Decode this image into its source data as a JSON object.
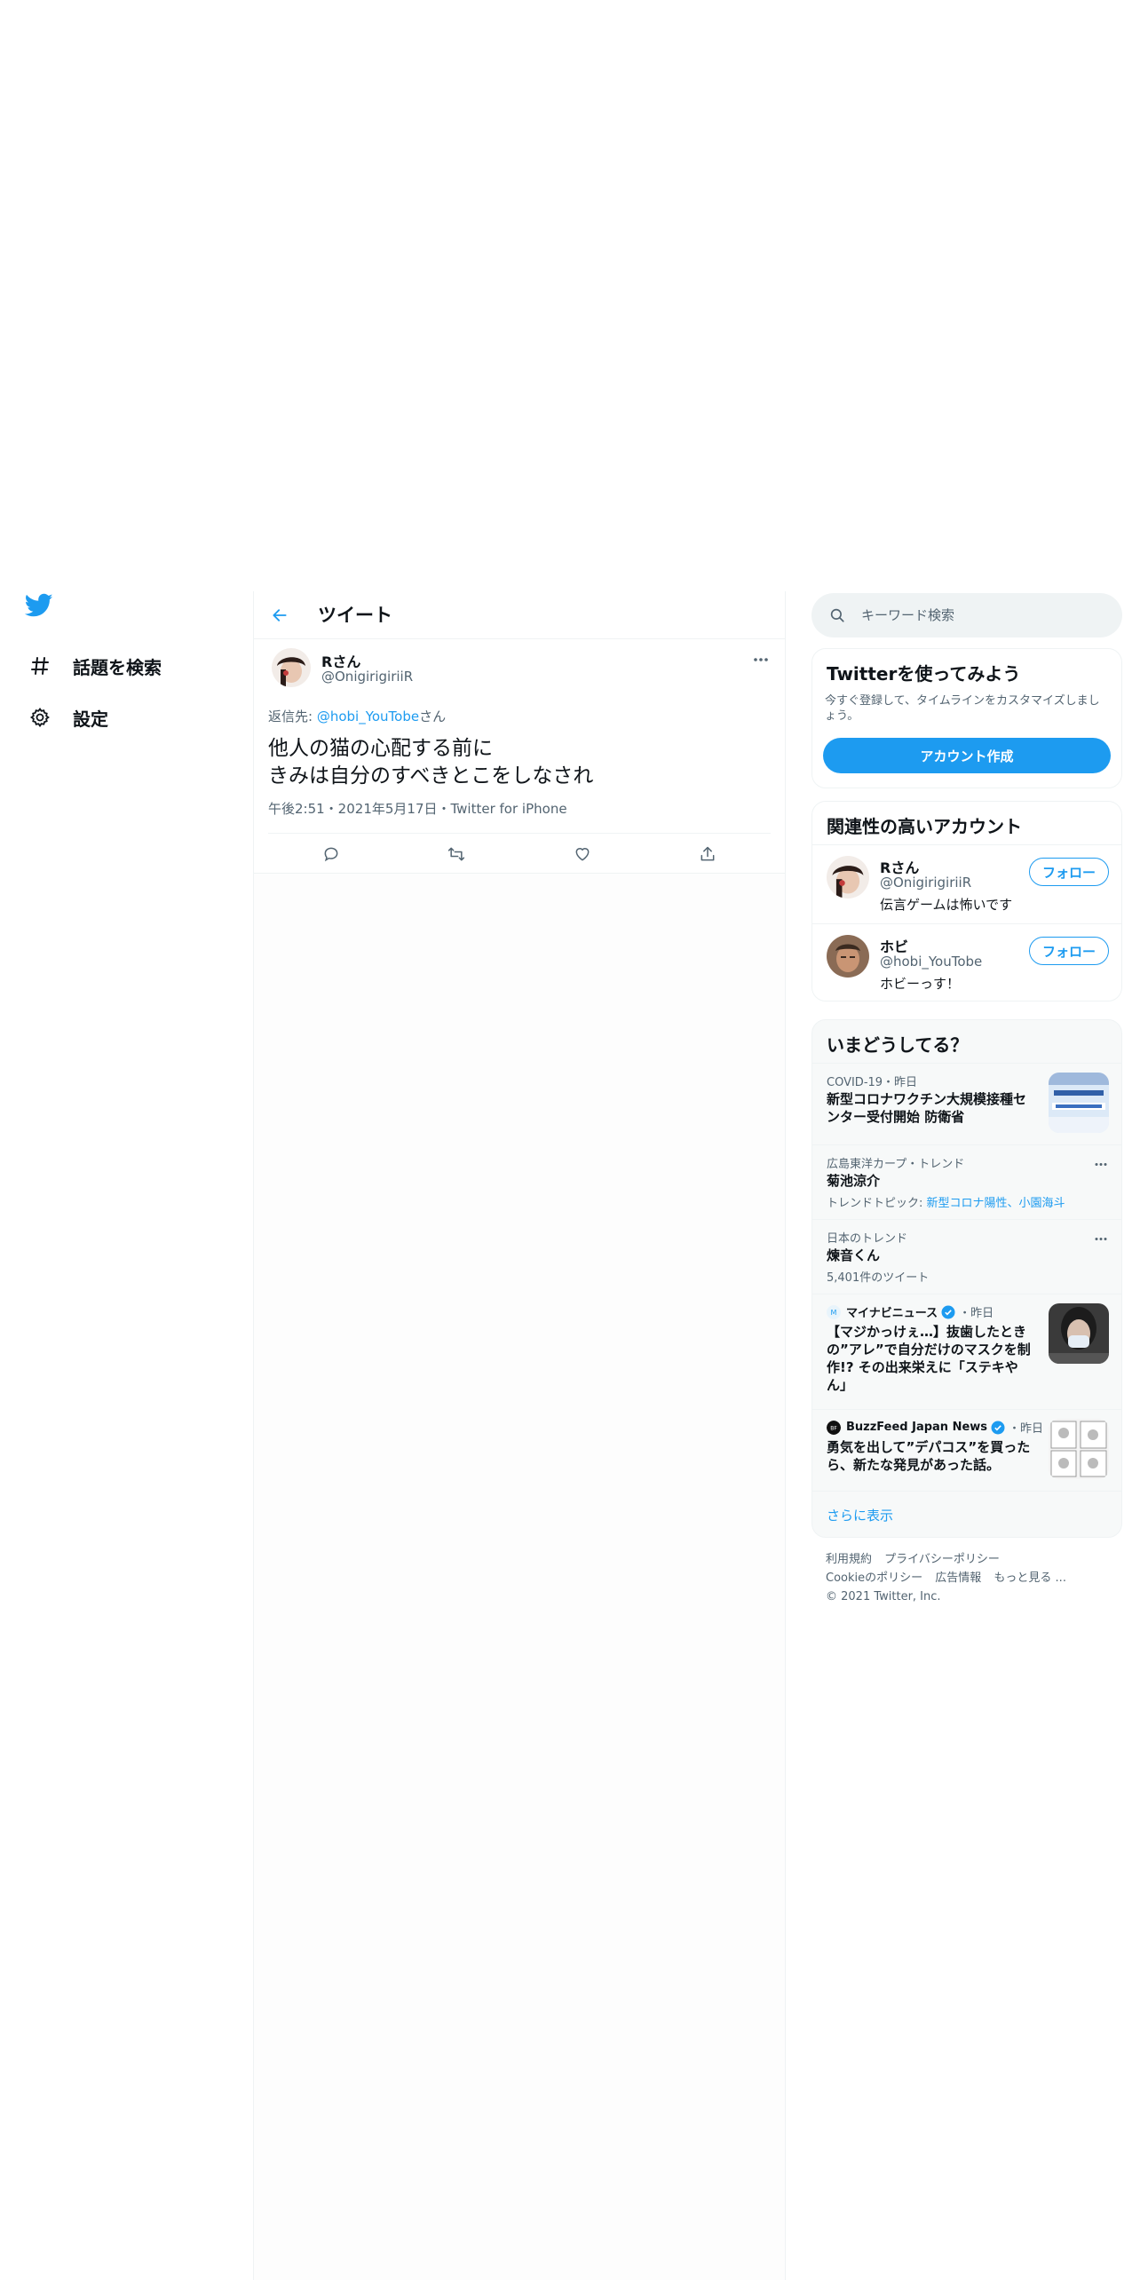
{
  "nav": {
    "logo": "twitter-bird-icon",
    "items": [
      {
        "icon": "hashtag-icon",
        "label": "話題を検索"
      },
      {
        "icon": "gear-icon",
        "label": "設定"
      }
    ]
  },
  "header": {
    "back_icon": "back-arrow-icon",
    "title": "ツイート"
  },
  "tweet": {
    "name": "Rさん",
    "handle": "@OnigirigiriiR",
    "reply_prefix": "返信先: ",
    "reply_link": "@hobi_YouTobe",
    "reply_suffix": "さん",
    "text_line1": "他人の猫の心配する前に",
    "text_line2": "きみは自分のすべきとこをしなされ",
    "meta": "午後2:51・2021年5月17日・Twitter for iPhone",
    "actions": [
      "reply-icon",
      "retweet-icon",
      "like-icon",
      "share-icon"
    ]
  },
  "search": {
    "placeholder": "キーワード検索"
  },
  "signup": {
    "title": "Twitterを使ってみよう",
    "desc": "今すぐ登録して、タイムラインをカスタマイズしましょう。",
    "button": "アカウント作成"
  },
  "related": {
    "title": "関連性の高いアカウント",
    "follow_label": "フォロー",
    "accounts": [
      {
        "name": "Rさん",
        "handle": "@OnigirigiriiR",
        "bio": "伝言ゲームは怖いです"
      },
      {
        "name": "ホビ",
        "handle": "@hobi_YouTobe",
        "bio": "ホビーっす！"
      }
    ]
  },
  "trends": {
    "title": "いまどうしてる？",
    "items": [
      {
        "context": "COVID-19・昨日",
        "title_line1": "新型コロナワクチン大規模接種セ",
        "title_line2": "ンター受付開始 防衛省"
      },
      {
        "context": "広島東洋カープ・トレンド",
        "title": "菊池涼介",
        "sub_prefix": "トレンドトピック: ",
        "sub_links": "新型コロナ陽性、小園海斗"
      },
      {
        "context": "日本のトレンド",
        "title": "煉音くん",
        "sub": "5,401件のツイート"
      },
      {
        "source": "マイナビニュース",
        "time": "・昨日",
        "title_line1": "【マジかっけぇ…】抜歯したとき",
        "title_line2": "の”アレ”で自分だけのマスクを制",
        "title_line3": "作!? その出来栄えに「ステキや",
        "title_line4": "ん」"
      },
      {
        "source": "BuzzFeed Japan News",
        "time": "・昨日",
        "title_line1": "勇気を出して”デパコス”を買った",
        "title_line2": "ら、新たな発見があった話。"
      }
    ],
    "show_more": "さらに表示"
  },
  "footer": {
    "links_row1": [
      "利用規約",
      "プライバシーポリシー"
    ],
    "links_row2": [
      "Cookieのポリシー",
      "広告情報",
      "もっと見る ..."
    ],
    "copyright": "© 2021 Twitter, Inc."
  },
  "colors": {
    "accent": "#1d9bf0",
    "text": "#0f1419",
    "muted": "#536471",
    "border": "#eff3f4"
  }
}
